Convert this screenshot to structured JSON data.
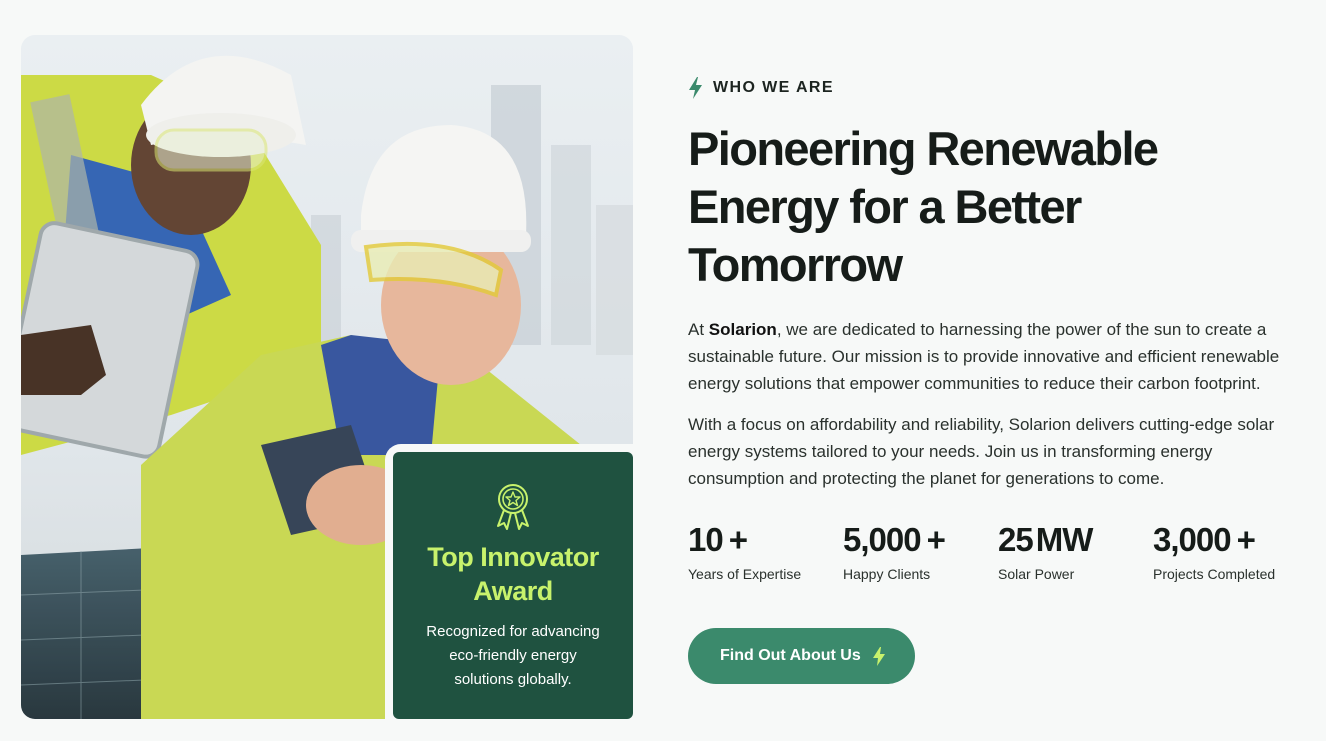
{
  "award": {
    "title": "Top Innovator Award",
    "description": "Recognized for advancing eco-friendly energy solutions globally."
  },
  "about": {
    "eyebrow": "WHO WE ARE",
    "headline": "Pioneering Renewable Energy for a Better Tomorrow",
    "paragraph1_prefix": "At ",
    "brand": "Solarion",
    "paragraph1_suffix": ", we are dedicated to harnessing the power of the sun to create a sustainable future. Our mission is to provide innovative and efficient renewable energy solutions that empower communities to reduce their carbon footprint.",
    "paragraph2": "With a focus on affordability and reliability, Solarion delivers cutting-edge solar energy systems tailored to your needs. Join us in transforming energy consumption and protecting the planet for generations to come.",
    "cta_label": "Find Out About Us"
  },
  "stats": [
    {
      "value": "10",
      "suffix": "+",
      "label": "Years of Expertise"
    },
    {
      "value": "5,000",
      "suffix": "+",
      "label": "Happy Clients"
    },
    {
      "value": "25",
      "suffix": "MW",
      "label": "Solar Power"
    },
    {
      "value": "3,000",
      "suffix": "+",
      "label": "Projects Completed"
    }
  ],
  "colors": {
    "accent_green": "#3b8a6c",
    "card_green": "#1f5240",
    "lime": "#c8f26c"
  },
  "icons": {
    "eyebrow": "bolt-icon",
    "award": "award-ribbon-icon",
    "cta": "bolt-icon"
  }
}
